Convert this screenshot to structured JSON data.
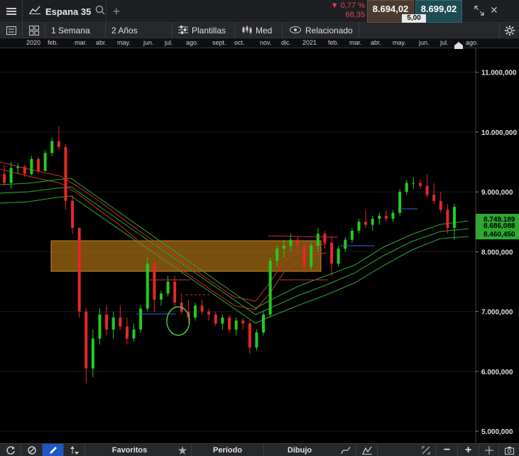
{
  "header": {
    "symbol": "Espana 35",
    "change_pct": "▼ 0,77 %",
    "change_abs": "68,35",
    "bid": "8.694,02",
    "ask": "8.699,02",
    "spread": "5,00"
  },
  "toolbar": {
    "interval": "1 Semana",
    "range": "2 Años",
    "templates": "Plantillas",
    "chart_type": "Med",
    "related": "Relacionado"
  },
  "timeaxis": [
    "2020",
    "feb.",
    "mar.",
    "abr.",
    "may.",
    "jun.",
    "jul.",
    "ago.",
    "sept.",
    "oct.",
    "nov.",
    "dic.",
    "2021",
    "feb.",
    "mar.",
    "abr.",
    "may.",
    "jun.",
    "jul.",
    "ago."
  ],
  "price_axis": {
    "ticks": [
      "11.000,000",
      "10.000,000",
      "9.000,000",
      "8.000,000",
      "7.000,000",
      "6.000,000",
      "5.000,000"
    ],
    "tag_upper": "8.749,189",
    "tag_mid": "8.686,088",
    "tag_lower": "8.460,450"
  },
  "bottombar": {
    "favorites": "Favoritos",
    "period": "Período",
    "drawing": "Dibujo"
  },
  "chart_data": {
    "type": "candlestick",
    "period": "weekly",
    "ylim": [
      4800000,
      11400000
    ],
    "y_ticks": [
      11000000,
      10000000,
      9000000,
      8000000,
      7000000,
      6000000,
      5000000
    ],
    "candles": [
      [
        9300000,
        9450000,
        9100000,
        9150000
      ],
      [
        9150000,
        9500000,
        9050000,
        9400000
      ],
      [
        9400000,
        9480000,
        9300000,
        9420000
      ],
      [
        9420000,
        9450000,
        9250000,
        9300000
      ],
      [
        9300000,
        9600000,
        9280000,
        9550000
      ],
      [
        9550000,
        9580000,
        9300000,
        9350000
      ],
      [
        9350000,
        9700000,
        9340000,
        9650000
      ],
      [
        9650000,
        9900000,
        9600000,
        9850000
      ],
      [
        9850000,
        10100000,
        9700000,
        9750000
      ],
      [
        9750000,
        9800000,
        8700000,
        8850000
      ],
      [
        8850000,
        8950000,
        8300000,
        8400000
      ],
      [
        8400000,
        8400000,
        6900000,
        7000000
      ],
      [
        7000000,
        7050000,
        5800000,
        6050000
      ],
      [
        6050000,
        6700000,
        5900000,
        6550000
      ],
      [
        6550000,
        7050000,
        6450000,
        6950000
      ],
      [
        6950000,
        7100000,
        6600000,
        6700000
      ],
      [
        6700000,
        7000000,
        6550000,
        6900000
      ],
      [
        6900000,
        7100000,
        6700000,
        6750000
      ],
      [
        6750000,
        6900000,
        6450000,
        6550000
      ],
      [
        6550000,
        6800000,
        6500000,
        6700000
      ],
      [
        6700000,
        7100000,
        6650000,
        7050000
      ],
      [
        7050000,
        7900000,
        7000000,
        7800000
      ],
      [
        7800000,
        7850000,
        7000000,
        7200000
      ],
      [
        7200000,
        7350000,
        7100000,
        7300000
      ],
      [
        7300000,
        7600000,
        7250000,
        7500000
      ],
      [
        7500000,
        7600000,
        7050000,
        7150000
      ],
      [
        7150000,
        7300000,
        6950000,
        7000000
      ],
      [
        7000000,
        7200000,
        6800000,
        6900000
      ],
      [
        6900000,
        7150000,
        6850000,
        7100000
      ],
      [
        7100000,
        7200000,
        6950000,
        7000000
      ],
      [
        7000000,
        7050000,
        6850000,
        6950000
      ],
      [
        6950000,
        7000000,
        6750000,
        6800000
      ],
      [
        6800000,
        6950000,
        6700000,
        6900000
      ],
      [
        6900000,
        6950000,
        6650000,
        6700000
      ],
      [
        6700000,
        6900000,
        6600000,
        6850000
      ],
      [
        6850000,
        6900000,
        6700000,
        6800000
      ],
      [
        6800000,
        6850000,
        6300000,
        6400000
      ],
      [
        6400000,
        6700000,
        6350000,
        6650000
      ],
      [
        6650000,
        7000000,
        6600000,
        6950000
      ],
      [
        6950000,
        7900000,
        6900000,
        7850000
      ],
      [
        7850000,
        8100000,
        7750000,
        8050000
      ],
      [
        8050000,
        8200000,
        7900000,
        8100000
      ],
      [
        8100000,
        8300000,
        8000000,
        8200000
      ],
      [
        8200000,
        8250000,
        8050000,
        8100000
      ],
      [
        8100000,
        8150000,
        7650000,
        7750000
      ],
      [
        7750000,
        8150000,
        7700000,
        8100000
      ],
      [
        8100000,
        8400000,
        8000000,
        8300000
      ],
      [
        8300000,
        8350000,
        8050000,
        8150000
      ],
      [
        8150000,
        8250000,
        7600000,
        7800000
      ],
      [
        7800000,
        8100000,
        7750000,
        8050000
      ],
      [
        8050000,
        8250000,
        8000000,
        8200000
      ],
      [
        8200000,
        8400000,
        8150000,
        8350000
      ],
      [
        8350000,
        8550000,
        8300000,
        8500000
      ],
      [
        8500000,
        8700000,
        8400000,
        8450000
      ],
      [
        8450000,
        8600000,
        8350000,
        8550000
      ],
      [
        8550000,
        8650000,
        8450000,
        8600000
      ],
      [
        8600000,
        8700000,
        8500000,
        8550000
      ],
      [
        8550000,
        8700000,
        8500000,
        8650000
      ],
      [
        8650000,
        9050000,
        8600000,
        9000000
      ],
      [
        9000000,
        9200000,
        8950000,
        9150000
      ],
      [
        9150000,
        9250000,
        9050000,
        9150000
      ],
      [
        9150000,
        9200000,
        9050000,
        9100000
      ],
      [
        9100000,
        9300000,
        8900000,
        8950000
      ],
      [
        8950000,
        9150000,
        8800000,
        8850000
      ],
      [
        8850000,
        9000000,
        8650000,
        8700000
      ],
      [
        8700000,
        8800000,
        8300000,
        8400000
      ],
      [
        8400000,
        8800000,
        8200000,
        8750000
      ]
    ],
    "marked_zone": [
      7760000,
      8330000
    ]
  }
}
